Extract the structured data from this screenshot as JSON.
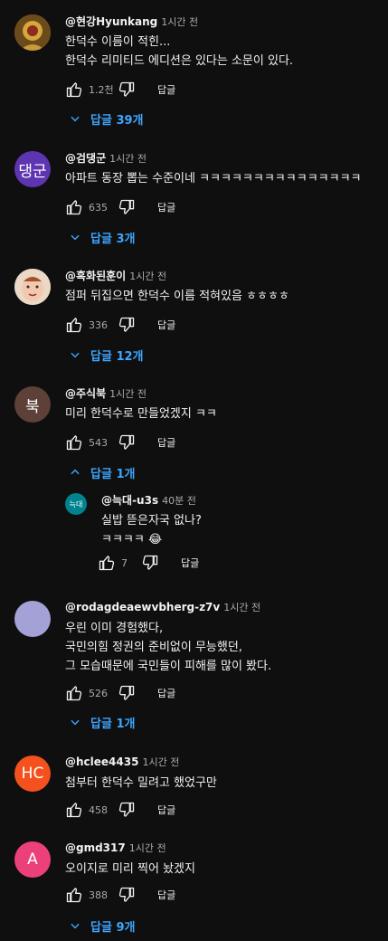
{
  "comments": [
    {
      "author": "@현강Hyunkang",
      "time": "1시간 전",
      "lines": "한덕수 이름이 적힌...\n한덕수 리미티드 에디션은 있다는 소문이 있다.",
      "likes": "1.2천",
      "reply_label": "답글",
      "toggle": "답글 39개",
      "avatar_text": "",
      "avatar_color": "#b08a2e"
    },
    {
      "author": "@검댕군",
      "time": "1시간 전",
      "lines": "아파트 동장 뽑는 수준이네 ㅋㅋㅋㅋㅋㅋㅋㅋㅋㅋㅋㅋㅋㅋㅋ",
      "likes": "635",
      "reply_label": "답글",
      "toggle": "답글 3개",
      "avatar_text": "댕군",
      "avatar_color": "#5e35b1"
    },
    {
      "author": "@흑화된훈이",
      "time": "1시간 전",
      "lines": "점퍼 뒤집으면 한덕수 이름 적혀있음 ㅎㅎㅎㅎ",
      "likes": "336",
      "reply_label": "답글",
      "toggle": "답글 12개",
      "avatar_text": "",
      "avatar_color": "#e8d5c0"
    },
    {
      "author": "@주식북",
      "time": "1시간 전",
      "lines": "미리 한덕수로 만들었겠지 ㅋㅋ",
      "likes": "543",
      "reply_label": "답글",
      "toggle": "답글 1개",
      "avatar_text": "북",
      "avatar_color": "#5d4037"
    },
    {
      "author": "@rodagdeaewvbherg-z7v",
      "time": "1시간 전",
      "lines": "우린 이미 경험했다,\n국민의힘 정권의 준비없이 무능했던,\n그 모습때문에 국민들이 피해를 많이 봤다.",
      "likes": "526",
      "reply_label": "답글",
      "toggle": "답글 1개",
      "avatar_text": "",
      "avatar_color": "#a3a1d6"
    },
    {
      "author": "@hclee4435",
      "time": "1시간 전",
      "lines": "첨부터 한덕수 밀려고 했었구만",
      "likes": "458",
      "reply_label": "답글",
      "avatar_text": "HC",
      "avatar_color": "#f4511e"
    },
    {
      "author": "@gmd317",
      "time": "1시간 전",
      "lines": "오이지로 미리 찍어 놨겠지",
      "likes": "388",
      "reply_label": "답글",
      "toggle": "답글 9개",
      "avatar_text": "A",
      "avatar_color": "#ec407a"
    }
  ],
  "reply": {
    "author": "@늑대-u3s",
    "time": "40분 전",
    "lines": "실밥 뜯은자국 없나?\nㅋㅋㅋㅋ 😂",
    "likes": "7",
    "reply_label": "답글",
    "avatar_text": "늑대",
    "avatar_color": "#00838f"
  },
  "colors": {
    "background": "#0f0f0f",
    "link": "#3ea6ff",
    "secondary_text": "#aaaaaa"
  }
}
